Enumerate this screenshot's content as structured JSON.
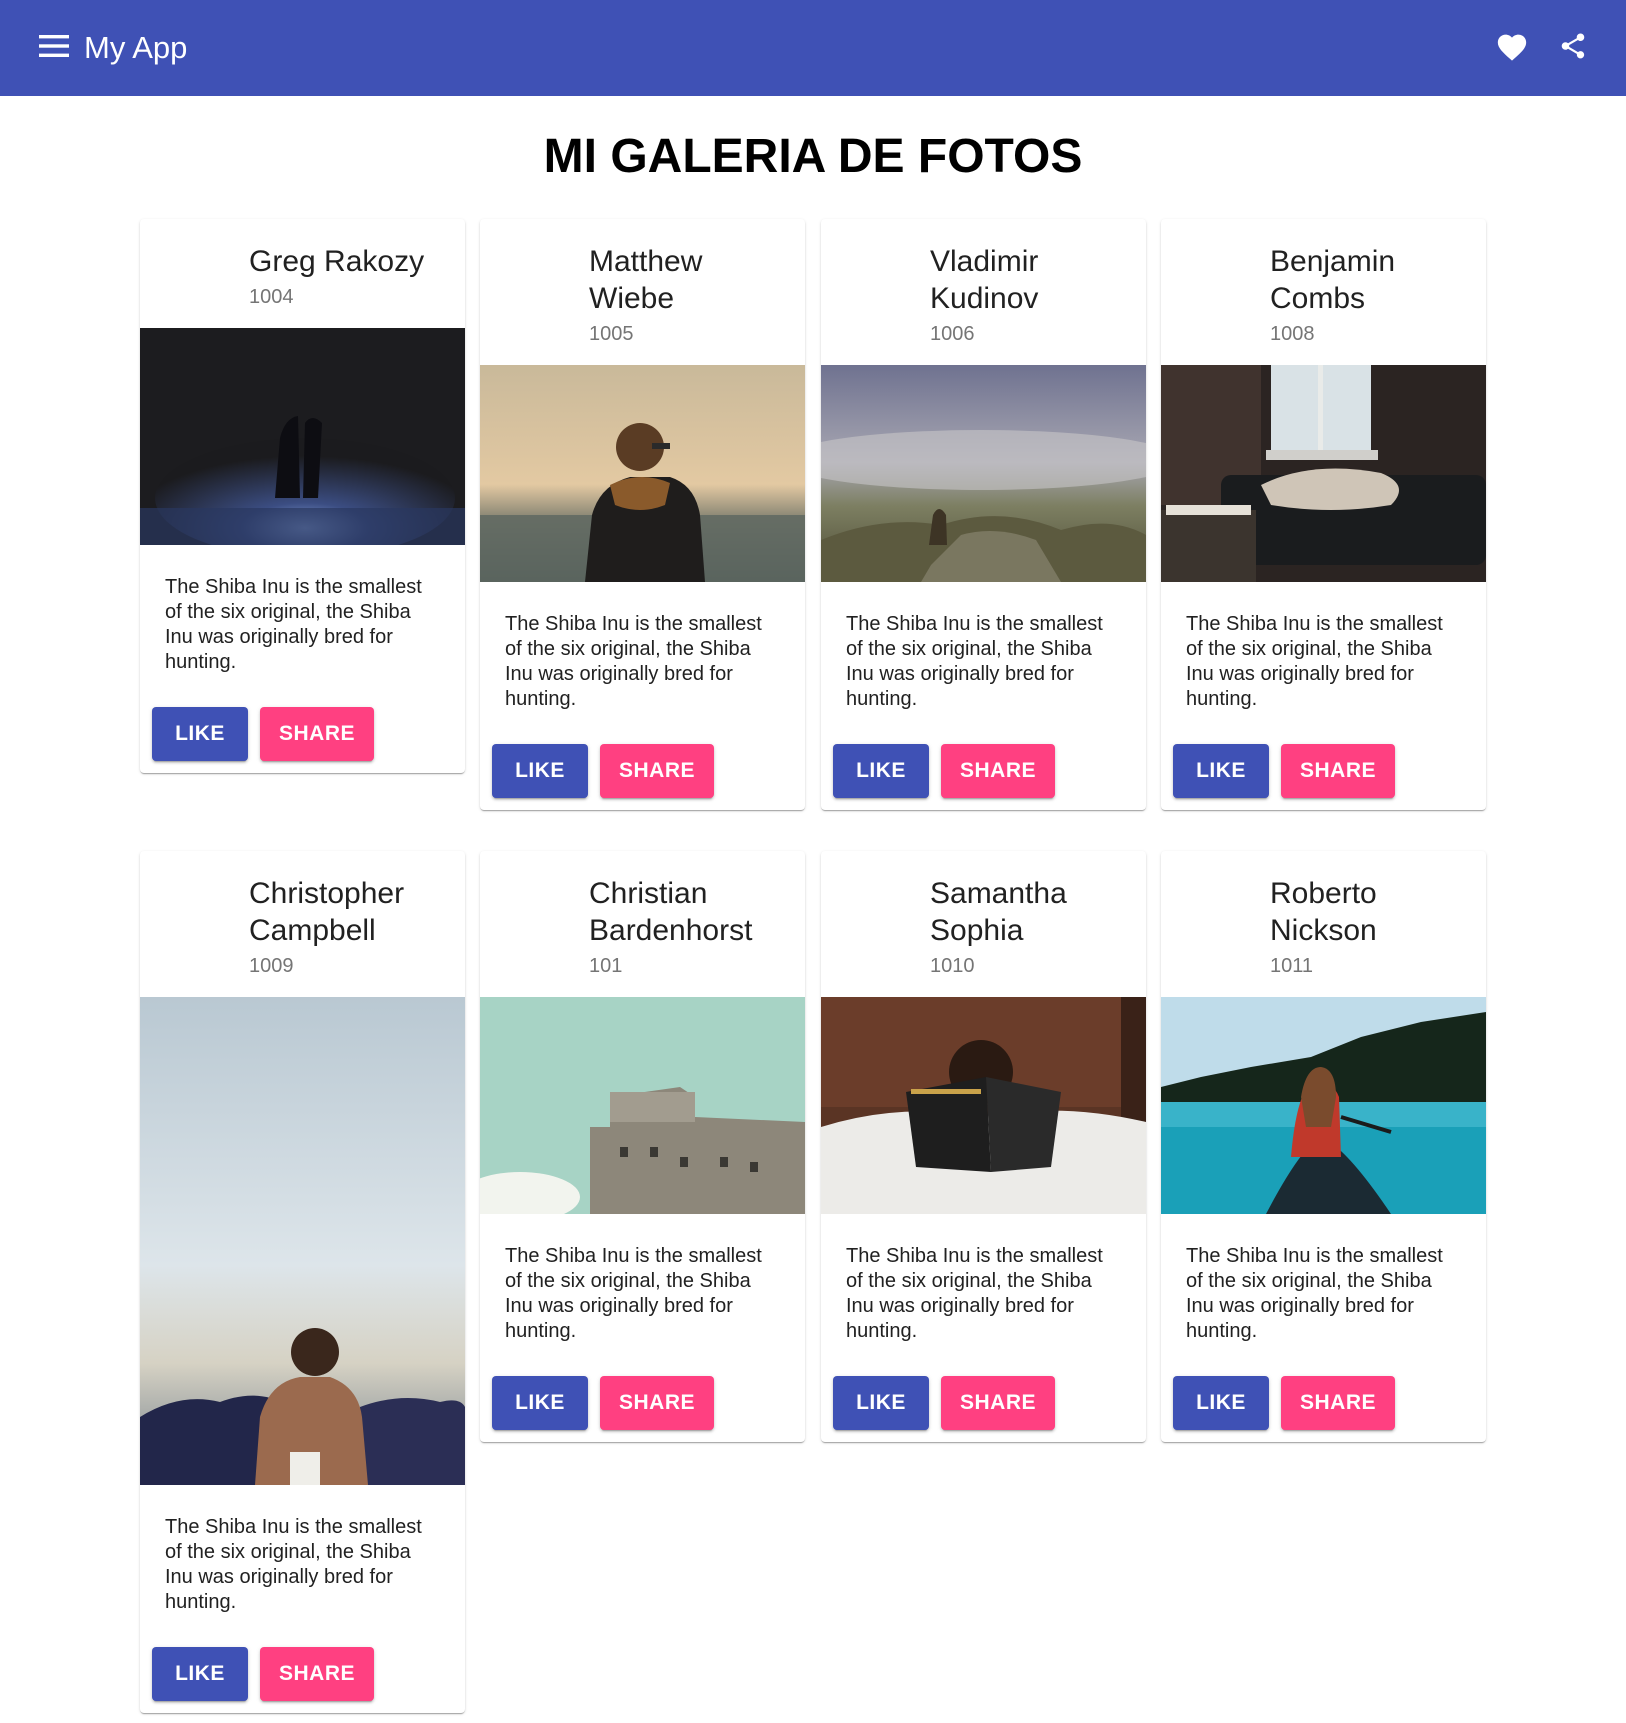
{
  "toolbar": {
    "title": "My App",
    "menu_icon": "menu-icon",
    "favorite_icon": "heart-icon",
    "share_icon": "share-icon",
    "background": "#3f51b5"
  },
  "page": {
    "title": "MI GALERIA DE FOTOS"
  },
  "cards": [
    {
      "title": "Greg Rakozy",
      "subtitle": "1004",
      "text": "The Shiba Inu is the smallest of the six original, the Shiba Inu was originally bred for hunting.",
      "like": "LIKE",
      "share": "SHARE"
    },
    {
      "title": "Matthew Wiebe",
      "subtitle": "1005",
      "text": "The Shiba Inu is the smallest of the six original, the Shiba Inu was originally bred for hunting.",
      "like": "LIKE",
      "share": "SHARE"
    },
    {
      "title": "Vladimir Kudinov",
      "subtitle": "1006",
      "text": "The Shiba Inu is the smallest of the six original, the Shiba Inu was originally bred for hunting.",
      "like": "LIKE",
      "share": "SHARE"
    },
    {
      "title": "Benjamin Combs",
      "subtitle": "1008",
      "text": "The Shiba Inu is the smallest of the six original, the Shiba Inu was originally bred for hunting.",
      "like": "LIKE",
      "share": "SHARE"
    },
    {
      "title": "Christopher Campbell",
      "subtitle": "1009",
      "text": "The Shiba Inu is the smallest of the six original, the Shiba Inu was originally bred for hunting.",
      "like": "LIKE",
      "share": "SHARE"
    },
    {
      "title": "Christian Bardenhorst",
      "subtitle": "101",
      "text": "The Shiba Inu is the smallest of the six original, the Shiba Inu was originally bred for hunting.",
      "like": "LIKE",
      "share": "SHARE"
    },
    {
      "title": "Samantha Sophia",
      "subtitle": "1010",
      "text": "The Shiba Inu is the smallest of the six original, the Shiba Inu was originally bred for hunting.",
      "like": "LIKE",
      "share": "SHARE"
    },
    {
      "title": "Roberto Nickson",
      "subtitle": "1011",
      "text": "The Shiba Inu is the smallest of the six original, the Shiba Inu was originally bred for hunting.",
      "like": "LIKE",
      "share": "SHARE"
    }
  ],
  "colors": {
    "primary": "#3f51b5",
    "accent": "#ff4081"
  }
}
